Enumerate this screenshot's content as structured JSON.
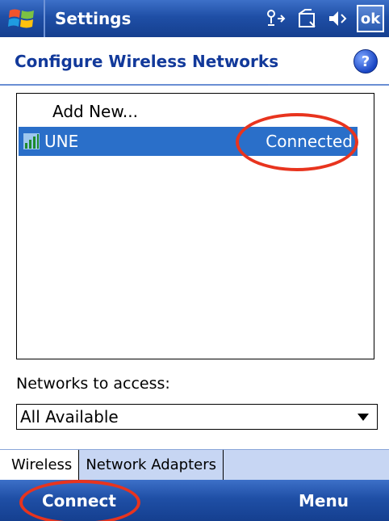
{
  "titlebar": {
    "title": "Settings",
    "ok_label": "ok",
    "status_icons": [
      "connectivity-icon",
      "battery-icon",
      "volume-icon"
    ]
  },
  "header": {
    "title": "Configure Wireless Networks",
    "help_label": "?"
  },
  "network_list": {
    "items": [
      {
        "label": "Add New..."
      },
      {
        "name": "UNE",
        "status": "Connected",
        "icon": "wireless-network-icon"
      }
    ]
  },
  "access": {
    "label": "Networks to access:",
    "selected": "All Available"
  },
  "tabs": [
    {
      "label": "Wireless"
    },
    {
      "label": "Network Adapters"
    }
  ],
  "softkeys": {
    "left": "Connect",
    "right": "Menu"
  },
  "colors": {
    "titlebar": "#1f4fa6",
    "selection": "#2a6fc9",
    "annotation": "#e8341e",
    "header_text": "#12399a"
  }
}
